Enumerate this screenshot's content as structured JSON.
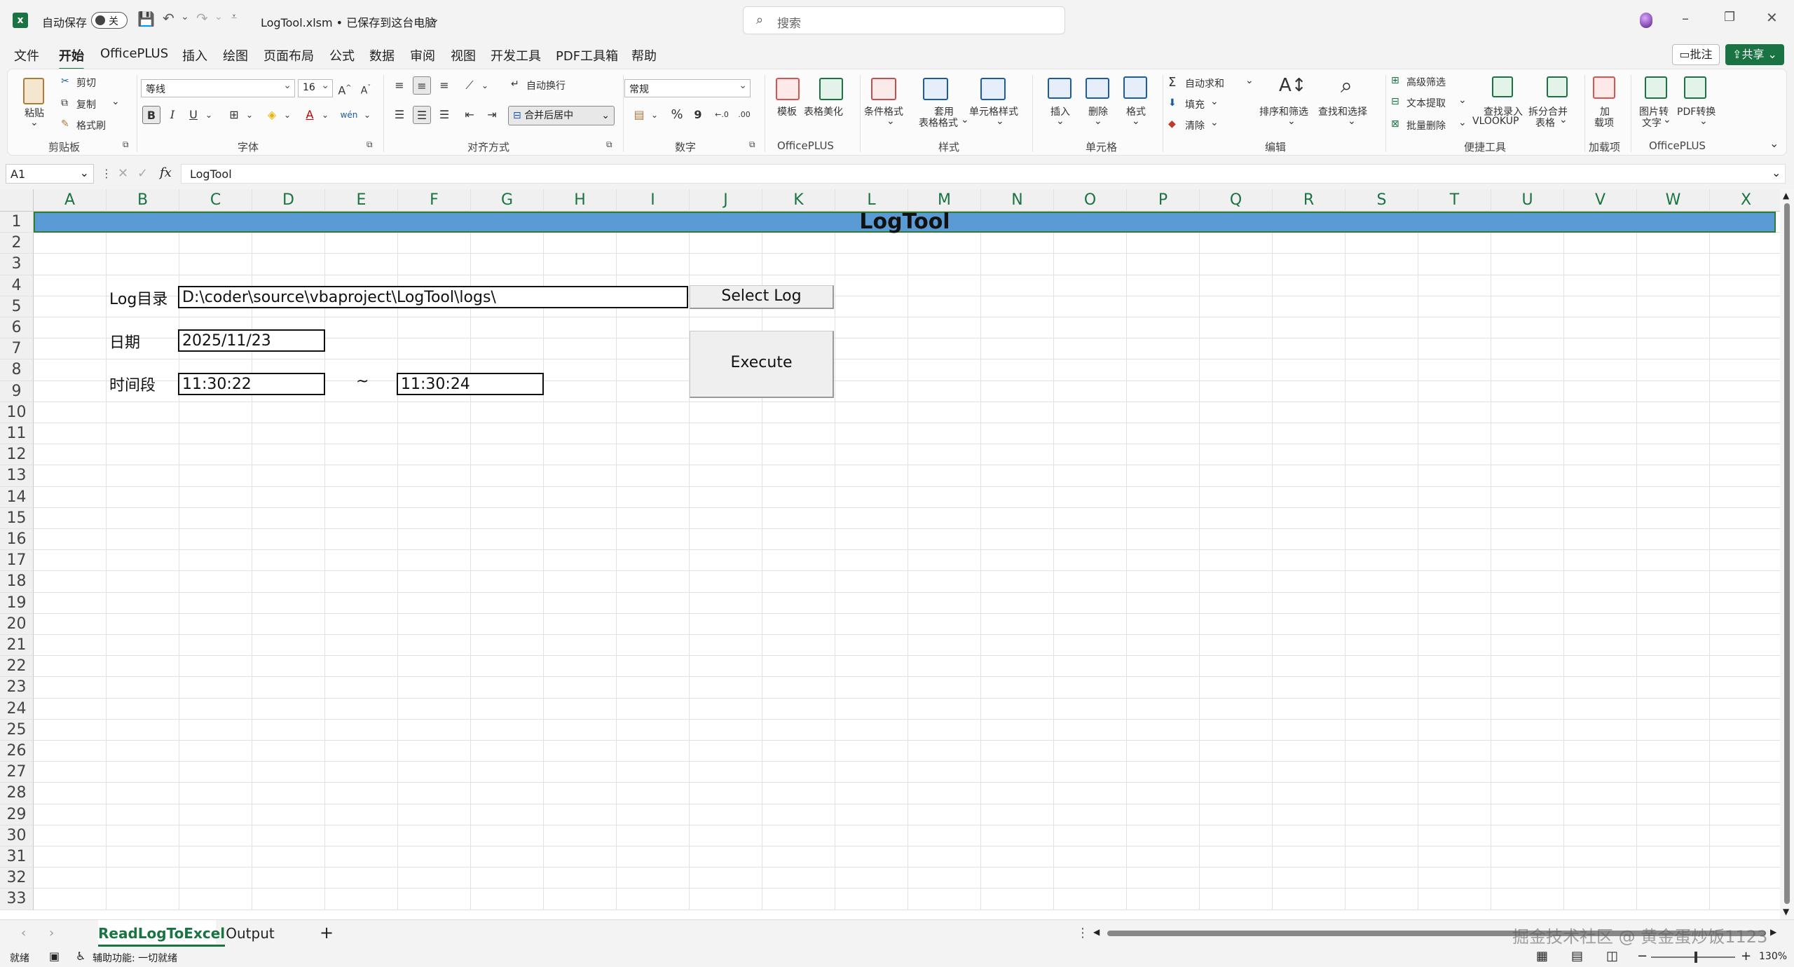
{
  "titlebar": {
    "autosave_label": "自动保存",
    "autosave_state": "关",
    "filename": "LogTool.xlsm • 已保存到这台电脑",
    "search_placeholder": "搜索",
    "comment_button": "批注",
    "share_button": "共享"
  },
  "menu": {
    "items": [
      "文件",
      "开始",
      "OfficePLUS",
      "插入",
      "绘图",
      "页面布局",
      "公式",
      "数据",
      "审阅",
      "视图",
      "开发工具",
      "PDF工具箱",
      "帮助"
    ],
    "active": "开始"
  },
  "ribbon": {
    "clipboard": {
      "paste": "粘贴",
      "cut": "剪切",
      "copy": "复制",
      "format_painter": "格式刷",
      "group": "剪贴板"
    },
    "font": {
      "name": "等线",
      "size": "16",
      "bold": "B",
      "italic": "I",
      "underline": "U",
      "group": "字体"
    },
    "alignment": {
      "wrap": "自动换行",
      "merge": "合并后居中",
      "group": "对齐方式"
    },
    "number": {
      "format": "常规",
      "percent": "%",
      "comma": "9",
      "group": "数字"
    },
    "officeplus": {
      "template": "模板",
      "beautify": "表格美化",
      "group": "OfficePLUS"
    },
    "styles": {
      "conditional": "条件格式",
      "table_format_1": "套用",
      "table_format_2": "表格格式",
      "cell_styles": "单元格样式",
      "group": "样式"
    },
    "cells": {
      "insert": "插入",
      "delete": "删除",
      "format": "格式",
      "group": "单元格"
    },
    "editing": {
      "autosum": "自动求和",
      "fill": "填充",
      "clear": "清除",
      "sort_filter": "排序和筛选",
      "find_select": "查找和选择",
      "group": "编辑"
    },
    "tools": {
      "advanced_filter": "高级筛选",
      "text_extract": "文本提取",
      "batch_delete": "批量删除",
      "lookup_1": "查找录入",
      "lookup_2": "VLOOKUP",
      "split_1": "拆分合并",
      "split_2": "表格",
      "group": "便捷工具"
    },
    "addins": {
      "label_1": "加",
      "label_2": "载项",
      "group": "加载项"
    },
    "officeplus2": {
      "img2text_1": "图片转",
      "img2text_2": "文字",
      "pdf": "PDF转换",
      "group": "OfficePLUS"
    }
  },
  "formula_bar": {
    "name_box": "A1",
    "fx": "fx",
    "content": "LogTool"
  },
  "columns": [
    "A",
    "B",
    "C",
    "D",
    "E",
    "F",
    "G",
    "H",
    "I",
    "J",
    "K",
    "L",
    "M",
    "N",
    "O",
    "P",
    "Q",
    "R",
    "S",
    "T",
    "U",
    "V",
    "W",
    "X"
  ],
  "rows": [
    "1",
    "2",
    "3",
    "4",
    "5",
    "6",
    "7",
    "8",
    "9",
    "10",
    "11",
    "12",
    "13",
    "14",
    "15",
    "16",
    "17",
    "18",
    "19",
    "20",
    "21",
    "22",
    "23",
    "24",
    "25",
    "26",
    "27",
    "28",
    "29",
    "30",
    "31",
    "32",
    "33"
  ],
  "sheet": {
    "title": "LogTool",
    "log_dir_label": "Log目录",
    "log_dir_value": "D:\\coder\\source\\vbaproject\\LogTool\\logs\\",
    "select_log_button": "Select Log",
    "date_label": "日期",
    "date_value": "2025/11/23",
    "execute_button": "Execute",
    "time_label": "时间段",
    "time_start": "11:30:22",
    "time_sep": "~",
    "time_end": "11:30:24"
  },
  "tabs": {
    "items": [
      "ReadLogToExcel",
      "Output"
    ],
    "active": "ReadLogToExcel",
    "add": "+"
  },
  "status": {
    "ready": "就绪",
    "accessibility": "辅助功能: 一切就绪",
    "zoom": "130%",
    "watermark": "掘金技术社区 @ 黄金蛋炒饭1123"
  },
  "colors": {
    "title_fill": "#5b9bd5",
    "accent": "#1a7343"
  }
}
